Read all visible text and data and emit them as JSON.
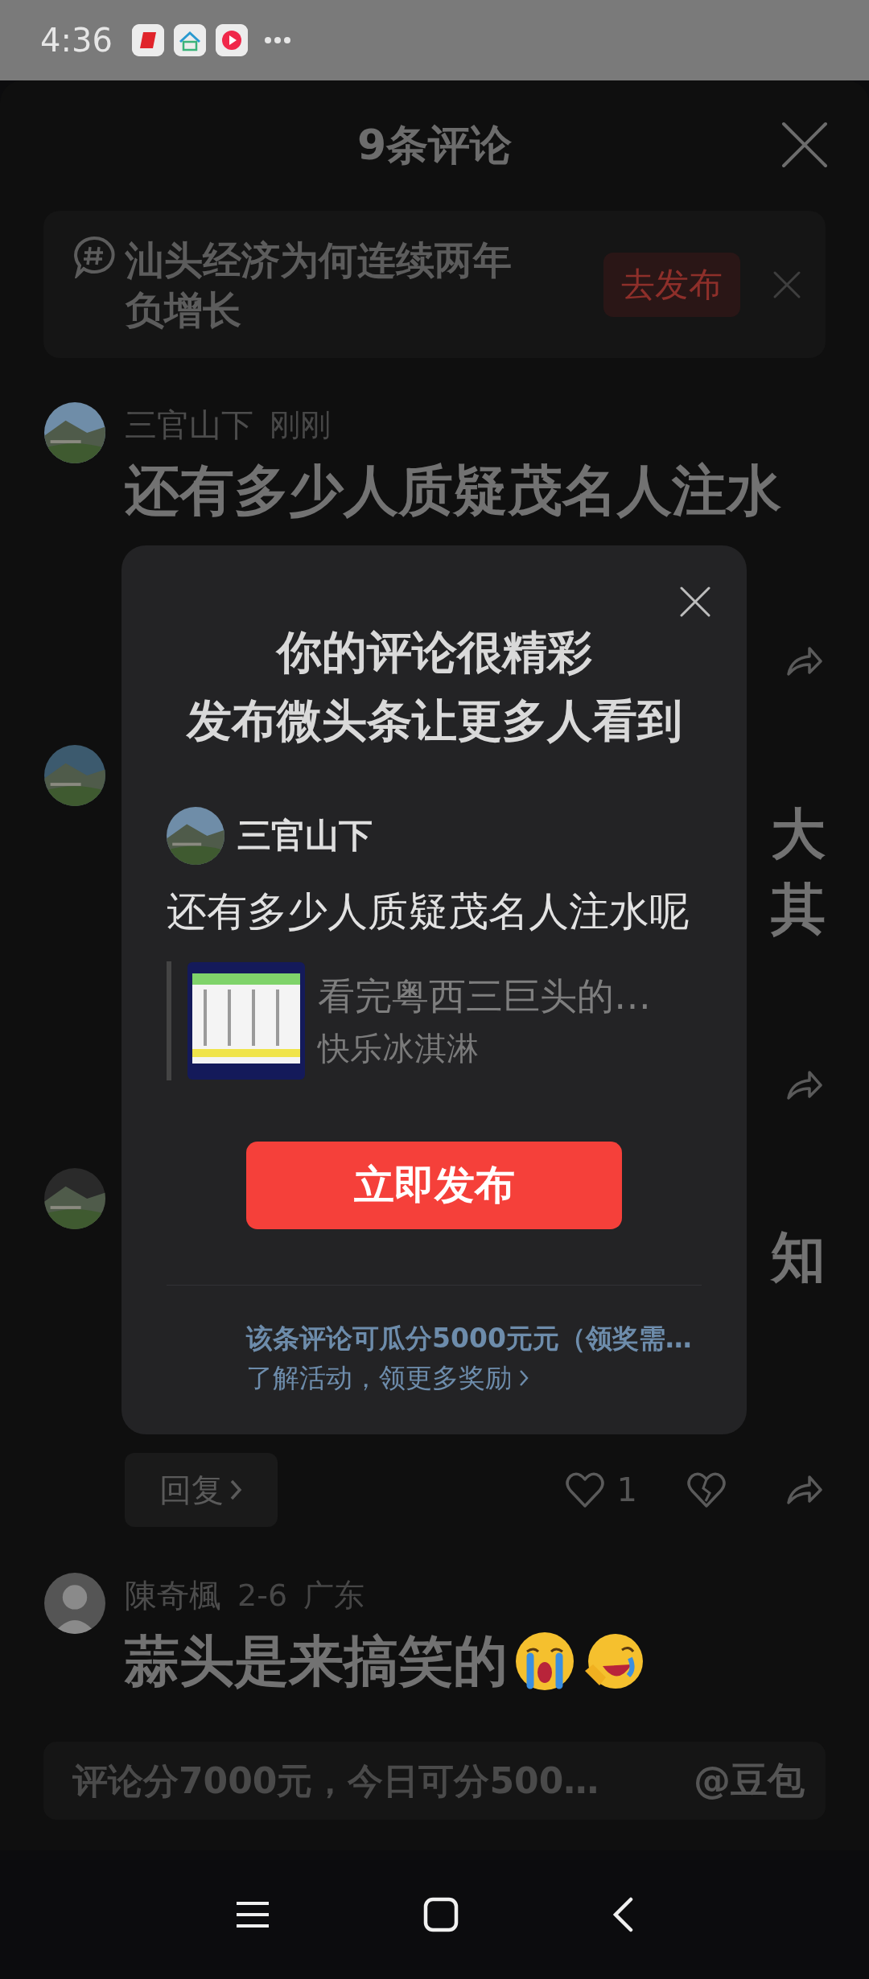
{
  "status_bar": {
    "time": "4:36",
    "app_icons": [
      {
        "kind": "slash"
      },
      {
        "kind": "house"
      },
      {
        "kind": "play"
      }
    ]
  },
  "sheet": {
    "title": "9条评论"
  },
  "topic_banner": {
    "text": "汕头经济为何连续两年负增长",
    "button": "去发布"
  },
  "comments": [
    {
      "avatar": {
        "kind": "picture"
      },
      "author": "三官山下",
      "meta": [
        "刚刚"
      ],
      "lines": [
        "还有多少人质疑茂名人注水"
      ],
      "actions": [
        {
          "kind": "share"
        }
      ]
    },
    {
      "avatar": {
        "kind": "picture"
      },
      "fragments": [
        "大",
        "其"
      ],
      "actions": [
        {
          "kind": "share"
        }
      ]
    },
    {
      "avatar": {
        "kind": "picture"
      },
      "fragments": [
        "知"
      ],
      "actions": [
        {
          "kind": "reply",
          "label": "回复"
        },
        {
          "kind": "like",
          "count": "1"
        },
        {
          "kind": "dislike"
        },
        {
          "kind": "share"
        }
      ]
    },
    {
      "avatar": {
        "kind": "silhouette"
      },
      "author": "陳奇楓",
      "meta": [
        "2-6",
        "广东"
      ],
      "lines": [
        "蒜头是来搞笑的"
      ],
      "emojis": [
        {
          "kind": "crying"
        },
        {
          "kind": "laughing"
        }
      ]
    }
  ],
  "publish_dialog": {
    "title_lines": [
      "你的评论很精彩",
      "发布微头条让更多人看到"
    ],
    "author": "三官山下",
    "comment": "还有多少人质疑茂名人注水呢",
    "quote": {
      "title": "看完粤西三巨头的…",
      "author": "快乐冰淇淋"
    },
    "button": "立即发布",
    "reward_text": "该条评论可瓜分5000元元（领奖需…",
    "reward_link": "了解活动，领更多奖励"
  },
  "input_bar": {
    "placeholder": "评论分7000元，今日可分500…",
    "mention": "@豆包"
  }
}
